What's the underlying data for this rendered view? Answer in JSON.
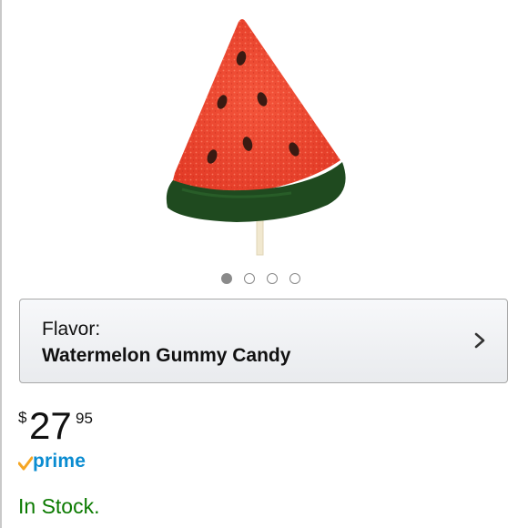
{
  "carousel": {
    "total_images": 4,
    "active_index": 0
  },
  "variation": {
    "label": "Flavor:",
    "value": "Watermelon Gummy Candy"
  },
  "price": {
    "symbol": "$",
    "whole": "27",
    "fraction": "95"
  },
  "prime": {
    "word": "prime"
  },
  "availability": {
    "text": "In Stock.",
    "color": "#0b7a00"
  },
  "icons": {
    "chevron": "chevron-right-icon",
    "prime_check": "prime-check-icon"
  },
  "colors": {
    "prime_blue": "#0a8cd1",
    "prime_orange": "#f5a623"
  }
}
